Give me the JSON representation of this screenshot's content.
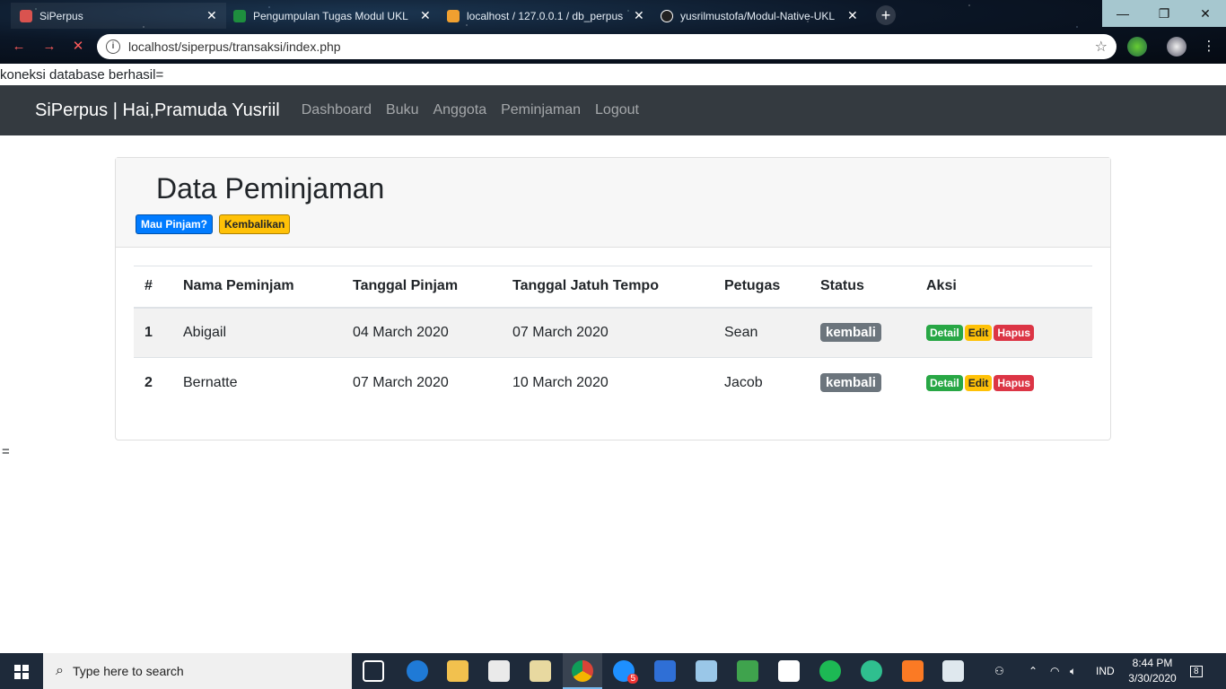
{
  "browser": {
    "tabs": [
      {
        "label": "SiPerpus",
        "color": "#d9534f"
      },
      {
        "label": "Pengumpulan Tugas Modul UKL",
        "color": "#1e8e3e"
      },
      {
        "label": "localhost / 127.0.0.1 / db_perpus",
        "color": "#f0a030"
      },
      {
        "label": "yusrilmustofa/Modul-Native-UKL",
        "color": "#222222"
      }
    ],
    "url": "localhost/siperpus/transaksi/index.php"
  },
  "page": {
    "db_message": "koneksi database berhasil=",
    "brand": "SiPerpus | Hai,Pramuda Yusriil",
    "nav": [
      "Dashboard",
      "Buku",
      "Anggota",
      "Peminjaman",
      "Logout"
    ],
    "title": "Data Peminjaman",
    "btn_pinjam": "Mau Pinjam?",
    "btn_kembali": "Kembalikan",
    "table": {
      "headers": [
        "#",
        "Nama Peminjam",
        "Tanggal Pinjam",
        "Tanggal Jatuh Tempo",
        "Petugas",
        "Status",
        "Aksi"
      ],
      "rows": [
        {
          "no": "1",
          "nama": "Abigail",
          "pinjam": "04 March 2020",
          "tempo": "07 March 2020",
          "petugas": "Sean",
          "status": "kembali"
        },
        {
          "no": "2",
          "nama": "Bernatte",
          "pinjam": "07 March 2020",
          "tempo": "10 March 2020",
          "petugas": "Jacob",
          "status": "kembali"
        }
      ],
      "actions": {
        "detail": "Detail",
        "edit": "Edit",
        "hapus": "Hapus"
      }
    },
    "footer_text": "="
  },
  "taskbar": {
    "search_placeholder": "Type here to search",
    "lang": "IND",
    "time": "8:44 PM",
    "date": "3/30/2020",
    "notif_count": "8",
    "badge": "5"
  }
}
